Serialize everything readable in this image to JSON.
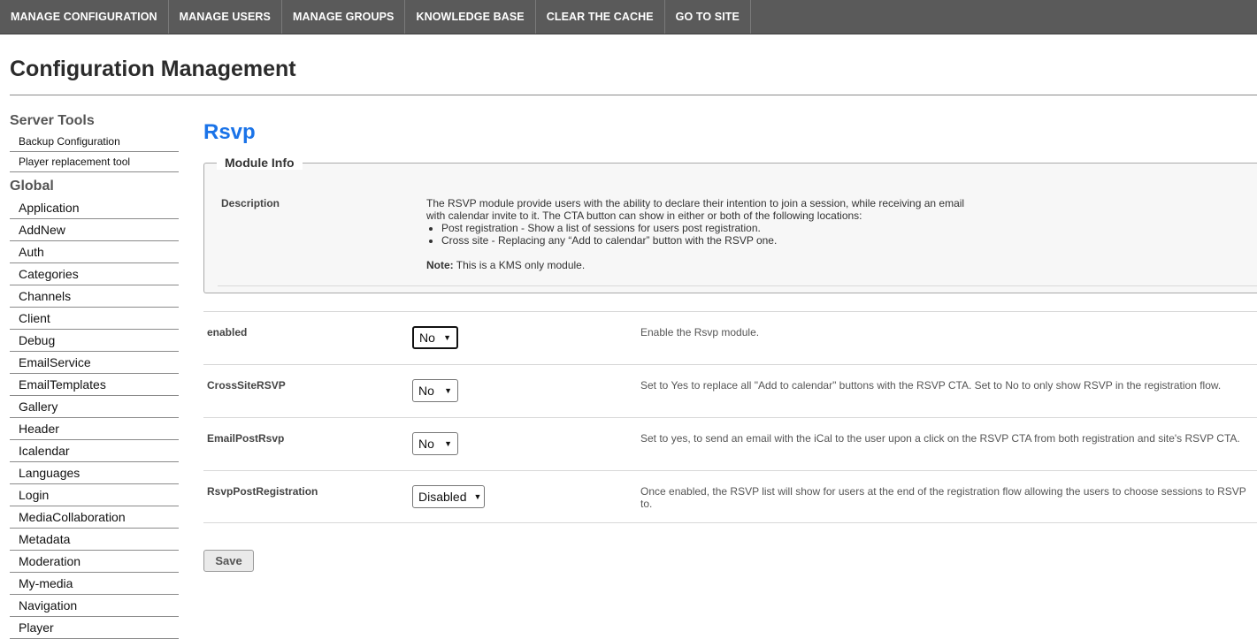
{
  "topnav": {
    "items": [
      "MANAGE CONFIGURATION",
      "MANAGE USERS",
      "MANAGE GROUPS",
      "KNOWLEDGE BASE",
      "CLEAR THE CACHE",
      "GO TO SITE"
    ]
  },
  "page": {
    "title": "Configuration Management"
  },
  "sidebar": {
    "server_tools_title": "Server Tools",
    "server_tools": [
      "Backup Configuration",
      "Player replacement tool"
    ],
    "global_title": "Global",
    "global_items": [
      "Application",
      "AddNew",
      "Auth",
      "Categories",
      "Channels",
      "Client",
      "Debug",
      "EmailService",
      "EmailTemplates",
      "Gallery",
      "Header",
      "Icalendar",
      "Languages",
      "Login",
      "MediaCollaboration",
      "Metadata",
      "Moderation",
      "My-media",
      "Navigation",
      "Player"
    ]
  },
  "module": {
    "title": "Rsvp",
    "info_legend": "Module Info",
    "description_label": "Description",
    "description_intro": "The RSVP module provide users with the ability to declare their intention to join a session, while receiving an email with calendar invite to it. The CTA button can show in either or both of the following locations:",
    "bullets": [
      "Post registration - Show a list of sessions for users post registration.",
      "Cross site - Replacing any “Add to calendar” button with the RSVP one."
    ],
    "note_label": "Note:",
    "note_text": " This is a KMS only module."
  },
  "settings": [
    {
      "name": "enabled",
      "value": "No",
      "help": "Enable the Rsvp module."
    },
    {
      "name": "CrossSiteRSVP",
      "value": "No",
      "help": "Set to Yes to replace all \"Add to calendar\" buttons with the RSVP CTA. Set to No to only show RSVP in the registration flow."
    },
    {
      "name": "EmailPostRsvp",
      "value": "No",
      "help": "Set to yes, to send an email with the iCal to the user upon a click on the RSVP CTA from both registration and site's RSVP CTA."
    },
    {
      "name": "RsvpPostRegistration",
      "value": "Disabled",
      "help": "Once enabled, the RSVP list will show for users at the end of the registration flow allowing the users to choose sessions to RSVP to."
    }
  ],
  "save_label": "Save",
  "icons": {
    "select_arrow": "chevron-down-icon"
  },
  "colors": {
    "nav_bg": "#5a5a5a",
    "title_accent": "#1a73e8"
  }
}
